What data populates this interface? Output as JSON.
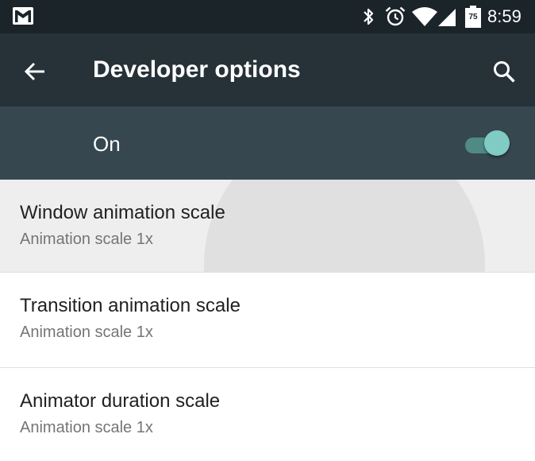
{
  "status_bar": {
    "notification_icon": "gmail-icon",
    "icons": [
      "bluetooth-icon",
      "alarm-icon",
      "wifi-icon",
      "signal-icon",
      "battery-icon"
    ],
    "battery_level": "75",
    "time": "8:59"
  },
  "toolbar": {
    "back_icon": "arrow-back-icon",
    "title": "Developer options",
    "search_icon": "search-icon"
  },
  "master_switch": {
    "label": "On",
    "checked": true
  },
  "settings": [
    {
      "title": "Window animation scale",
      "summary": "Animation scale 1x",
      "pressed": true
    },
    {
      "title": "Transition animation scale",
      "summary": "Animation scale 1x",
      "pressed": false
    },
    {
      "title": "Animator duration scale",
      "summary": "Animation scale 1x",
      "pressed": false
    }
  ],
  "colors": {
    "status_bar_bg": "#1b2429",
    "toolbar_bg": "#263238",
    "switch_bar_bg": "#37474f",
    "switch_thumb": "#80cbc4",
    "switch_track": "#4f8a84",
    "pressed_row_bg": "#eeeeee"
  }
}
